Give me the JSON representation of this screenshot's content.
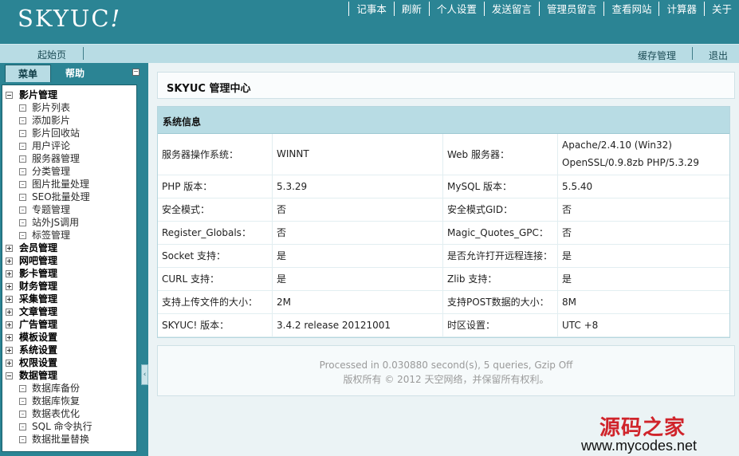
{
  "app": {
    "logo_main": "SKYUC",
    "logo_mark": "!"
  },
  "topnav": [
    "记事本",
    "刷新",
    "个人设置",
    "发送留言",
    "管理员留言",
    "查看网站",
    "计算器",
    "关于"
  ],
  "subbar": {
    "home": "起始页",
    "cache": "缓存管理",
    "logout": "退出"
  },
  "sidebar": {
    "tabs": {
      "menu": "菜单",
      "help": "帮助"
    },
    "groups": [
      {
        "label": "影片管理",
        "expanded": true,
        "items": [
          "影片列表",
          "添加影片",
          "影片回收站",
          "用户评论",
          "服务器管理",
          "分类管理",
          "图片批量处理",
          "SEO批量处理",
          "专题管理",
          "站外JS调用",
          "标签管理"
        ]
      },
      {
        "label": "会员管理",
        "expanded": false,
        "items": []
      },
      {
        "label": "网吧管理",
        "expanded": false,
        "items": []
      },
      {
        "label": "影卡管理",
        "expanded": false,
        "items": []
      },
      {
        "label": "财务管理",
        "expanded": false,
        "items": []
      },
      {
        "label": "采集管理",
        "expanded": false,
        "items": []
      },
      {
        "label": "文章管理",
        "expanded": false,
        "items": []
      },
      {
        "label": "广告管理",
        "expanded": false,
        "items": []
      },
      {
        "label": "模板设置",
        "expanded": false,
        "items": []
      },
      {
        "label": "系统设置",
        "expanded": false,
        "items": []
      },
      {
        "label": "权限设置",
        "expanded": false,
        "items": []
      },
      {
        "label": "数据管理",
        "expanded": true,
        "items": [
          "数据库备份",
          "数据库恢复",
          "数据表优化",
          "SQL 命令执行",
          "数据批量替换"
        ]
      }
    ]
  },
  "main": {
    "title": "SKYUC 管理中心",
    "sysinfo": {
      "header": "系统信息",
      "rows": [
        {
          "k1": "服务器操作系统：",
          "v1": "WINNT",
          "k2": "Web 服务器：",
          "v2a": "Apache/2.4.10 (Win32)",
          "v2b": "OpenSSL/0.9.8zb PHP/5.3.29"
        },
        {
          "k1": "PHP 版本：",
          "v1": "5.3.29",
          "k2": "MySQL 版本：",
          "v2a": "5.5.40"
        },
        {
          "k1": "安全模式：",
          "v1": "否",
          "k2": "安全模式GID：",
          "v2a": "否"
        },
        {
          "k1": "Register_Globals：",
          "v1": "否",
          "k2": "Magic_Quotes_GPC：",
          "v2a": "否"
        },
        {
          "k1": "Socket 支持：",
          "v1": "是",
          "k2": "是否允许打开远程连接：",
          "v2a": "是"
        },
        {
          "k1": "CURL 支持：",
          "v1": "是",
          "k2": "Zlib 支持：",
          "v2a": "是"
        },
        {
          "k1": "支持上传文件的大小：",
          "v1": "2M",
          "k2": "支持POST数据的大小：",
          "v2a": "8M"
        },
        {
          "k1": "SKYUC! 版本：",
          "v1": "3.4.2 release 20121001",
          "k2": "时区设置：",
          "v2a": "UTC +8"
        }
      ]
    },
    "footer": {
      "line1": "Processed in 0.030880 second(s), 5 queries, Gzip Off",
      "line2": "版权所有 © 2012 天空网络，并保留所有权利。"
    }
  },
  "watermark": {
    "cn": "源码之家",
    "url": "www.mycodes.net"
  },
  "colors": {
    "header_bg": "#2b8494",
    "subbar_bg": "#b8dce4",
    "main_bg": "#ebf3f5",
    "watermark_red": "#d0242b"
  }
}
